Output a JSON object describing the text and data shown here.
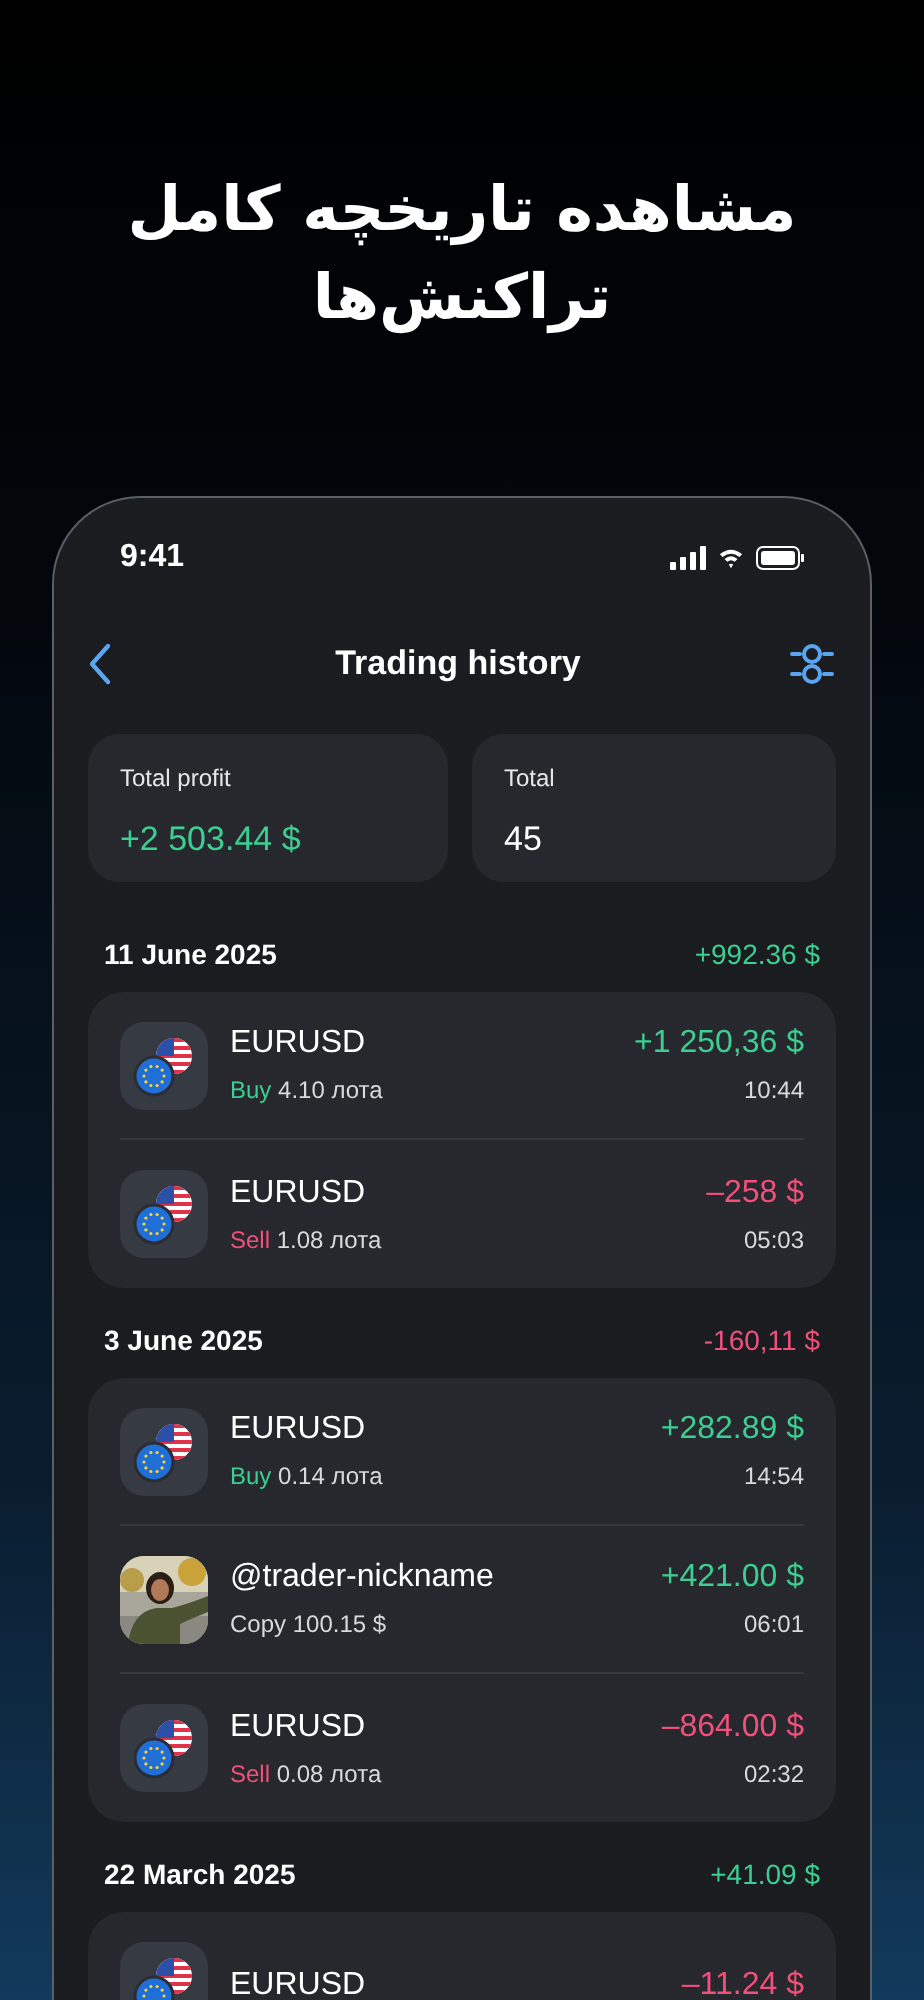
{
  "headline": "مشاهده تاریخچه کامل تراکنش‌ها",
  "status_bar": {
    "time": "9:41"
  },
  "nav": {
    "title": "Trading history"
  },
  "stats": [
    {
      "label": "Total profit",
      "value": "+2 503.44 $",
      "positive": true
    },
    {
      "label": "Total",
      "value": "45"
    }
  ],
  "groups": [
    {
      "date": "11 June 2025",
      "total": "+992.36 $",
      "positive": true,
      "rows": [
        {
          "kind": "trade",
          "name": "EURUSD",
          "side": "Buy",
          "sell": false,
          "detail": "4.10 лота",
          "amount": "+1 250,36 $",
          "positive": true,
          "time": "10:44"
        },
        {
          "kind": "trade",
          "name": "EURUSD",
          "side": "Sell",
          "sell": true,
          "detail": "1.08 лота",
          "amount": "–258 $",
          "positive": false,
          "time": "05:03"
        }
      ]
    },
    {
      "date": "3 June 2025",
      "total": "-160,11 $",
      "positive": false,
      "rows": [
        {
          "kind": "trade",
          "name": "EURUSD",
          "side": "Buy",
          "sell": false,
          "detail": "0.14 лота",
          "amount": "+282.89 $",
          "positive": true,
          "time": "14:54"
        },
        {
          "kind": "copy",
          "name": "@trader-nickname",
          "detail": "Copy 100.15 $",
          "amount": "+421.00 $",
          "positive": true,
          "time": "06:01"
        },
        {
          "kind": "trade",
          "name": "EURUSD",
          "side": "Sell",
          "sell": true,
          "detail": "0.08 лота",
          "amount": "–864.00 $",
          "positive": false,
          "time": "02:32"
        }
      ]
    },
    {
      "date": "22 March 2025",
      "total": "+41.09 $",
      "positive": true,
      "rows": [
        {
          "kind": "trade",
          "name": "EURUSD",
          "amount": "–11.24 $",
          "positive": false
        }
      ]
    }
  ]
}
